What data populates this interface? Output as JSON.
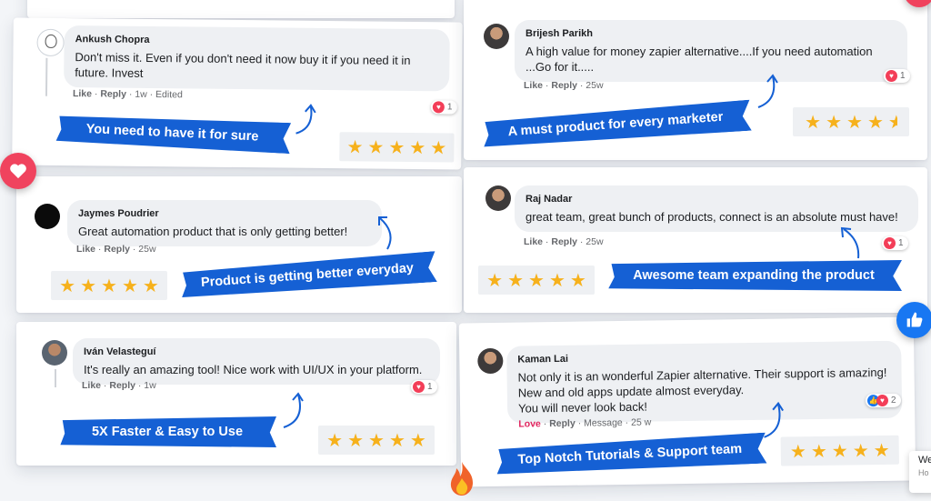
{
  "reviews": [
    {
      "name": "Ankush Chopra",
      "text": "Don't miss it. Even if you don't need it now buy it if you need it in\nfuture. Invest",
      "like": "Like",
      "reply": "Reply",
      "time": "1w",
      "edited": "Edited",
      "reactions": "1",
      "ribbon": "You need to have it for sure",
      "rating": 5
    },
    {
      "name": "Brijesh Parikh",
      "text": "A high value for money zapier alternative....If you need automation\n...Go for it.....",
      "like": "Like",
      "reply": "Reply",
      "time": "25w",
      "reactions": "1",
      "ribbon": "A must product for every marketer",
      "rating": 4.5
    },
    {
      "name": "Jaymes Poudrier",
      "text": "Great automation product that is only getting better!",
      "like": "Like",
      "reply": "Reply",
      "time": "25w",
      "ribbon": "Product is getting better everyday",
      "rating": 5
    },
    {
      "name": "Raj Nadar",
      "text": "great team, great bunch of products, connect is an absolute must have!",
      "like": "Like",
      "reply": "Reply",
      "time": "25w",
      "reactions": "1",
      "ribbon": "Awesome team expanding the product",
      "rating": 5
    },
    {
      "name": "Iván Velasteguí",
      "text": "It's really an amazing tool! Nice work with UI/UX in your platform.",
      "like": "Like",
      "reply": "Reply",
      "time": "1w",
      "reactions": "1",
      "ribbon": "5X Faster & Easy to Use",
      "rating": 5
    },
    {
      "name": "Kaman Lai",
      "text": "Not only it is an wonderful Zapier alternative. Their support is amazing!\nNew and old apps update almost everyday.\nYou will never look back!",
      "like": "Love",
      "reply": "Reply",
      "message": "Message",
      "time": "25 w",
      "reactions": "2",
      "ribbon": "Top Notch Tutorials & Support team",
      "rating": 5
    }
  ],
  "corner_widget": {
    "line1": "We",
    "line2": "Ho"
  },
  "icons": {
    "heart_badge": "heart-icon",
    "thumb_badge": "thumbs-up-icon",
    "fire_badge": "fire-icon"
  },
  "colors": {
    "ribbon": "#1560d4",
    "star": "#f6b11c",
    "heart": "#f33e58",
    "like_blue": "#1877f2"
  }
}
